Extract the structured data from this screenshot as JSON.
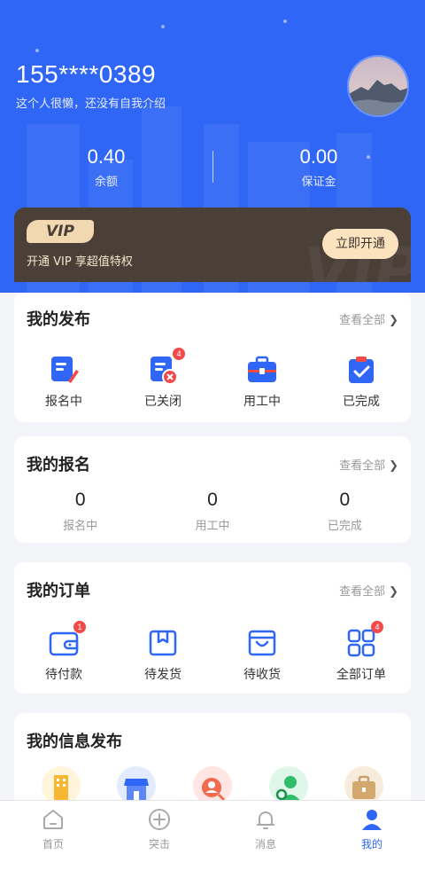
{
  "profile": {
    "phone": "155****0389",
    "bio": "这个人很懒，还没有自我介绍"
  },
  "stats": [
    {
      "value": "0.40",
      "label": "余额"
    },
    {
      "value": "0.00",
      "label": "保证金"
    }
  ],
  "vip": {
    "badge": "VIP",
    "text": "开通 VIP 享超值特权",
    "button": "立即开通"
  },
  "publish": {
    "title": "我的发布",
    "see_all": "查看全部",
    "items": [
      {
        "label": "报名中",
        "icon": "doc-edit-icon"
      },
      {
        "label": "已关闭",
        "icon": "doc-closed-icon",
        "badge": "4"
      },
      {
        "label": "用工中",
        "icon": "briefcase-icon"
      },
      {
        "label": "已完成",
        "icon": "clipboard-check-icon"
      }
    ]
  },
  "signup": {
    "title": "我的报名",
    "see_all": "查看全部",
    "items": [
      {
        "value": "0",
        "label": "报名中"
      },
      {
        "value": "0",
        "label": "用工中"
      },
      {
        "value": "0",
        "label": "已完成"
      }
    ]
  },
  "orders": {
    "title": "我的订单",
    "see_all": "查看全部",
    "items": [
      {
        "label": "待付款",
        "icon": "wallet-icon",
        "badge": "1"
      },
      {
        "label": "待发货",
        "icon": "package-icon"
      },
      {
        "label": "待收货",
        "icon": "shopping-bag-icon"
      },
      {
        "label": "全部订单",
        "icon": "grid-icon",
        "badge": "4"
      }
    ]
  },
  "info": {
    "title": "我的信息发布",
    "icons": [
      "building-icon",
      "store-icon",
      "person-search-icon",
      "person-icon",
      "briefcase-icon"
    ]
  },
  "tabbar": [
    {
      "label": "首页",
      "icon": "home-icon"
    },
    {
      "label": "突击",
      "icon": "plus-circle-icon"
    },
    {
      "label": "消息",
      "icon": "bell-icon"
    },
    {
      "label": "我的",
      "icon": "user-icon",
      "active": true
    }
  ],
  "colors": {
    "primary": "#2f66f5",
    "vip_bg": "#4a4038",
    "vip_gold": "#fbe3bf",
    "badge_red": "#f04a4a"
  }
}
